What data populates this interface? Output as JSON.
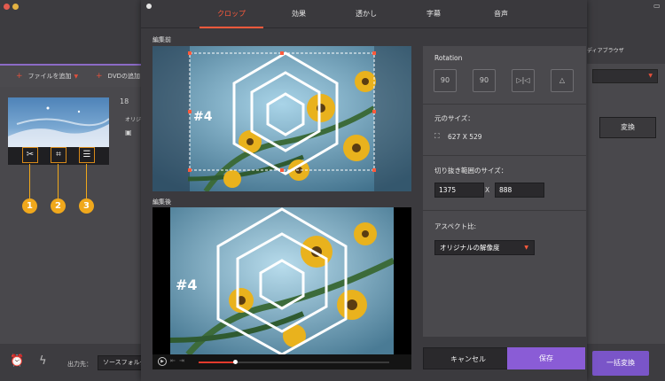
{
  "window": {
    "browser_label": "ディアブラウザ",
    "toolbar": {
      "add_file": "ファイルを追加",
      "add_dvd": "DVDの追加"
    },
    "video_item": {
      "count_text": "18",
      "original_label": "オリジ"
    },
    "convert_button": "変換",
    "bottom": {
      "output_label": "出力先：",
      "output_value": "ソースフォルダ",
      "batch_convert": "一括変換"
    },
    "badges": [
      "1",
      "2",
      "3"
    ]
  },
  "editor": {
    "tabs": [
      {
        "label": "クロップ",
        "active": true
      },
      {
        "label": "効果",
        "active": false
      },
      {
        "label": "透かし",
        "active": false
      },
      {
        "label": "字幕",
        "active": false
      },
      {
        "label": "音声",
        "active": false
      }
    ],
    "before_label": "編集前",
    "after_label": "編集後",
    "overlay_text": "#4",
    "player": {
      "progress": 0.19
    },
    "panel": {
      "rotation_title": "Rotation",
      "rotation_buttons": [
        {
          "icon": "rotate-left-90-icon",
          "text": "90"
        },
        {
          "icon": "rotate-right-90-icon",
          "text": "90"
        },
        {
          "icon": "flip-horizontal-icon",
          "text": ""
        },
        {
          "icon": "flip-vertical-icon",
          "text": ""
        }
      ],
      "original_size_title": "元のサイズ：",
      "original_size_value": "627 X 529",
      "crop_size_title": "切り抜き範囲のサイズ：",
      "crop_width": "1375",
      "crop_height": "888",
      "crop_x_label": "X",
      "aspect_title": "アスペクト比:",
      "aspect_value": "オリジナルの解像度"
    },
    "cancel_button": "キャンセル",
    "save_button": "保存"
  },
  "colors": {
    "accent_orange": "#ff5a3c",
    "save_purple": "#8a5cd6",
    "badge_orange": "#f0a81c"
  }
}
